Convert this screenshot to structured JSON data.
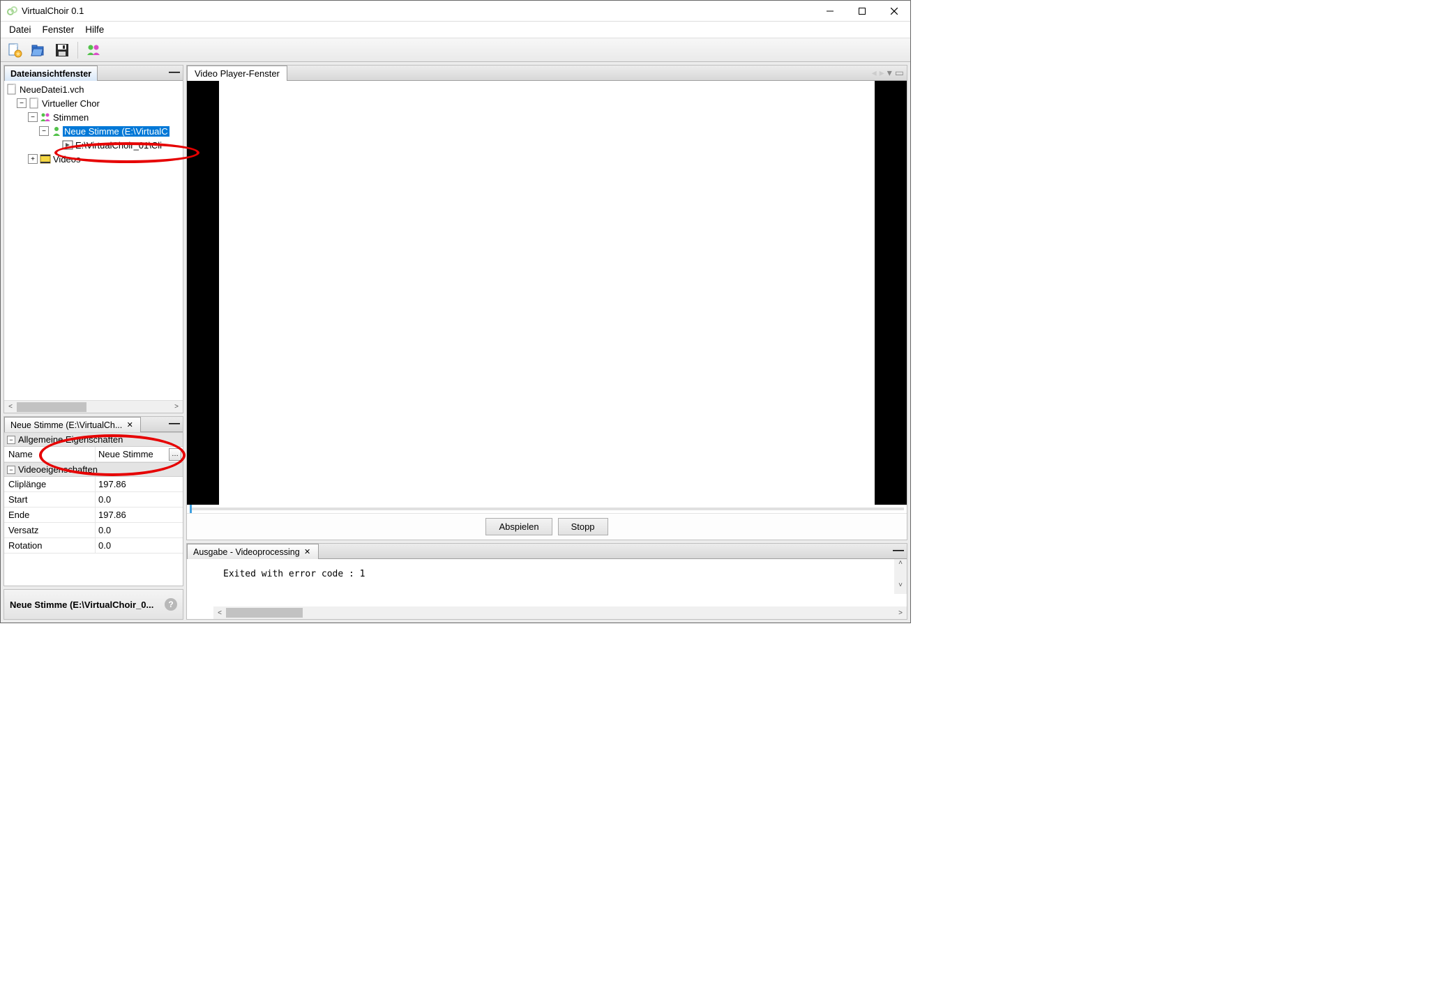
{
  "window": {
    "title": "VirtualChoir 0.1"
  },
  "menu": {
    "file": "Datei",
    "window": "Fenster",
    "help": "Hilfe"
  },
  "panels": {
    "tree_title": "Dateiansichtfenster",
    "video_title": "Video Player-Fenster",
    "prop_title": "Neue Stimme (E:\\VirtualCh...",
    "output_title": "Ausgabe - Videoprocessing",
    "status_title": "Neue Stimme (E:\\VirtualChoir_0..."
  },
  "tree": {
    "root": "NeueDatei1.vch",
    "virt": "Virtueller Chor",
    "stimmen": "Stimmen",
    "neue_stimme": "Neue Stimme (E:\\VirtualC",
    "clip": "E:\\VirtualChoir_01\\Cli",
    "videos": "Videos"
  },
  "props": {
    "sec_general": "Allgemeine Eigenschaften",
    "name_label": "Name",
    "name_value": "Neue Stimme",
    "sec_video": "Videoeigenschaften",
    "cliplen_label": "Cliplänge",
    "cliplen_value": "197.86",
    "start_label": "Start",
    "start_value": "0.0",
    "end_label": "Ende",
    "end_value": "197.86",
    "offset_label": "Versatz",
    "offset_value": "0.0",
    "rotation_label": "Rotation",
    "rotation_value": "0.0"
  },
  "controls": {
    "play": "Abspielen",
    "stop": "Stopp"
  },
  "output": {
    "text": "Exited with error code : 1"
  }
}
